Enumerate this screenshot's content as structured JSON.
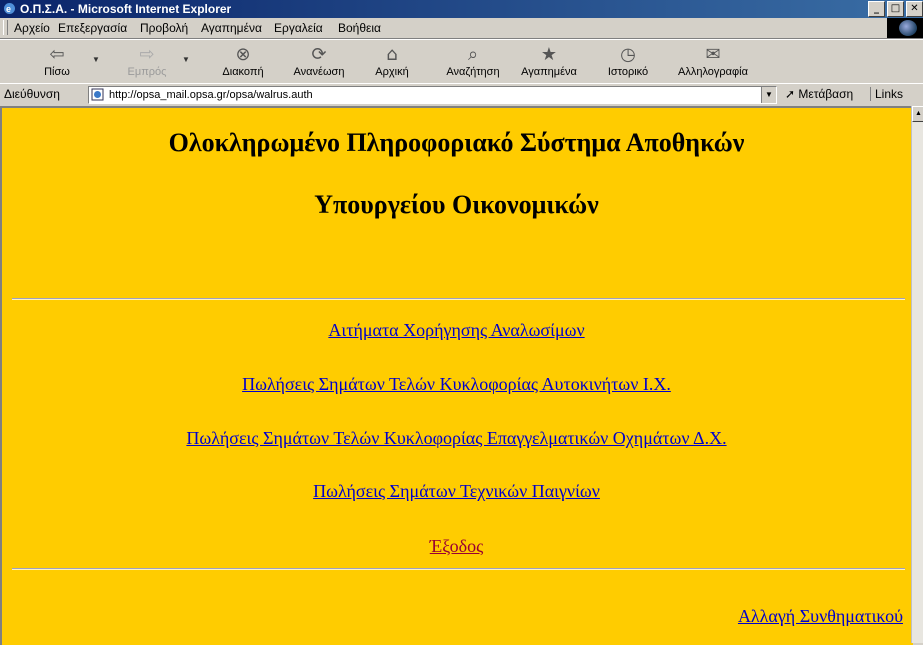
{
  "window": {
    "title": "Ο.Π.Σ.Α. - Microsoft Internet Explorer",
    "min_glyph": "_",
    "max_glyph": "□",
    "close_glyph": "✕"
  },
  "menu": {
    "items": [
      {
        "label": "Αρχείο"
      },
      {
        "label": "Επεξεργασία"
      },
      {
        "label": "Προβολή"
      },
      {
        "label": "Αγαπημένα"
      },
      {
        "label": "Εργαλεία"
      },
      {
        "label": "Βοήθεια"
      }
    ]
  },
  "toolbar": {
    "back": {
      "label": "Πίσω",
      "icon": "⇦"
    },
    "forward": {
      "label": "Εμπρός",
      "icon": "⇨"
    },
    "stop": {
      "label": "Διακοπή",
      "icon": "⊗"
    },
    "refresh": {
      "label": "Ανανέωση",
      "icon": "⟳"
    },
    "home": {
      "label": "Αρχική",
      "icon": "⌂"
    },
    "search": {
      "label": "Αναζήτηση",
      "icon": "⌕"
    },
    "favorites": {
      "label": "Αγαπημένα",
      "icon": "★"
    },
    "history": {
      "label": "Ιστορικό",
      "icon": "◷"
    },
    "mail": {
      "label": "Αλληλογραφία",
      "icon": "✉"
    }
  },
  "address": {
    "label": "Διεύθυνση",
    "url": "http://opsa_mail.opsa.gr/opsa/walrus.auth",
    "go_label": "Μετάβαση",
    "links_label": "Links"
  },
  "page": {
    "title_line1": "Ολοκληρωμένο Πληροφοριακό Σύστημα Αποθηκών",
    "title_line2": "Υπουργείου Οικονομικών",
    "links": [
      "Αιτήματα Χορήγησης Αναλωσίμων",
      "Πωλήσεις Σημάτων Τελών Κυκλοφορίας Αυτοκινήτων Ι.Χ.",
      "Πωλήσεις Σημάτων Τελών Κυκλοφορίας Επαγγελματικών Οχημάτων Δ.Χ.",
      "Πωλήσεις Σημάτων Τεχνικών Παιγνίων"
    ],
    "exit": "Έξοδος",
    "change_password": "Αλλαγή Συνθηματικού"
  },
  "colors": {
    "page_background": "#ffcc00",
    "link": "#0000cc",
    "visited_link": "#990033"
  }
}
